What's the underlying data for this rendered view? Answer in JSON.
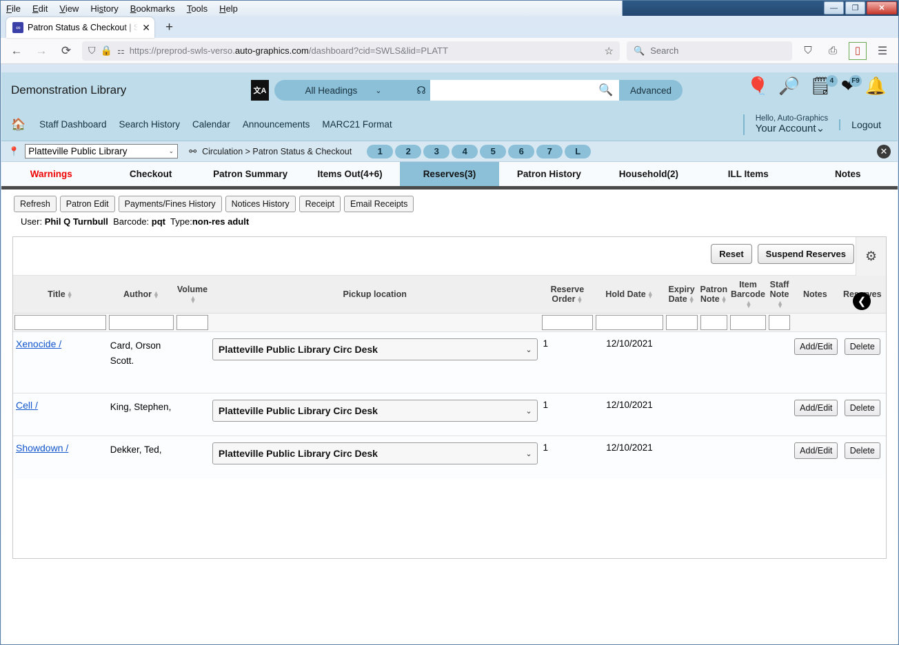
{
  "browser": {
    "menus": [
      "File",
      "Edit",
      "View",
      "History",
      "Bookmarks",
      "Tools",
      "Help"
    ],
    "window_controls": {
      "minimize": "—",
      "restore": "❐",
      "close": "✕"
    },
    "tab": {
      "title": "Patron Status & Checkout | SWL",
      "close": "✕",
      "newtab": "+"
    },
    "nav": {
      "back": "←",
      "forward": "→",
      "reload": "⟳"
    },
    "url": {
      "prefix": "https://preprod-swls-verso.",
      "host": "auto-graphics.com",
      "suffix": "/dashboard?cid=SWLS&lid=PLATT"
    },
    "search_placeholder": "Search",
    "bookmark_star": "☆"
  },
  "app": {
    "library_name": "Demonstration Library",
    "search": {
      "scope": "All Headings",
      "value": "",
      "advanced": "Advanced"
    },
    "account": {
      "hello": "Hello, Auto-Graphics",
      "your_account": "Your Account",
      "logout": "Logout"
    },
    "badges": {
      "list_count": "4",
      "heart_label": "F9"
    },
    "nav_links": [
      "Staff Dashboard",
      "Search History",
      "Calendar",
      "Announcements",
      "MARC21 Format"
    ],
    "breadcrumb": {
      "library": "Platteville Public Library",
      "path": "Circulation > Patron Status & Checkout",
      "pills": [
        "1",
        "2",
        "3",
        "4",
        "5",
        "6",
        "7",
        "L"
      ]
    },
    "tabs": [
      {
        "label": "Warnings",
        "state": "warning"
      },
      {
        "label": "Checkout",
        "state": "normal"
      },
      {
        "label": "Patron Summary",
        "state": "normal"
      },
      {
        "label": "Items Out(4+6)",
        "state": "normal"
      },
      {
        "label": "Reserves(3)",
        "state": "active"
      },
      {
        "label": "Patron History",
        "state": "normal"
      },
      {
        "label": "Household(2)",
        "state": "normal"
      },
      {
        "label": "ILL Items",
        "state": "normal"
      },
      {
        "label": "Notes",
        "state": "normal"
      }
    ],
    "action_buttons": [
      "Refresh",
      "Patron Edit",
      "Payments/Fines History",
      "Notices History",
      "Receipt",
      "Email Receipts"
    ],
    "patron": {
      "user_label": "User:",
      "user_name": "Phil Q Turnbull",
      "barcode_label": "Barcode:",
      "barcode": "pqt",
      "type_label": "Type:",
      "type": "non-res adult"
    },
    "panel": {
      "reset": "Reset",
      "suspend": "Suspend Reserves",
      "columns": [
        {
          "label": "Title",
          "sortable": true
        },
        {
          "label": "Author",
          "sortable": true
        },
        {
          "label": "Volume",
          "sortable": true
        },
        {
          "label": "Pickup location",
          "sortable": false
        },
        {
          "label": "Reserve Order",
          "sortable": true
        },
        {
          "label": "Hold Date",
          "sortable": true
        },
        {
          "label": "Expiry Date",
          "sortable": true
        },
        {
          "label": "Patron Note",
          "sortable": true
        },
        {
          "label": "Item Barcode",
          "sortable": true
        },
        {
          "label": "Staff Note",
          "sortable": true
        },
        {
          "label": "Notes",
          "sortable": false
        },
        {
          "label": "Reserves",
          "sortable": false
        }
      ],
      "rows": [
        {
          "title": "Xenocide /",
          "author": "Card, Orson Scott.",
          "volume": "",
          "pickup": "Platteville Public Library Circ Desk",
          "reserve_order": "1",
          "hold_date": "12/10/2021",
          "expiry_date": "",
          "patron_note": "",
          "item_barcode": "",
          "staff_note": "",
          "notes_button": "Add/Edit",
          "reserves_button": "Delete"
        },
        {
          "title": "Cell /",
          "author": "King, Stephen,",
          "volume": "",
          "pickup": "Platteville Public Library Circ Desk",
          "reserve_order": "1",
          "hold_date": "12/10/2021",
          "expiry_date": "",
          "patron_note": "",
          "item_barcode": "",
          "staff_note": "",
          "notes_button": "Add/Edit",
          "reserves_button": "Delete"
        },
        {
          "title": "Showdown /",
          "author": "Dekker, Ted,",
          "volume": "",
          "pickup": "Platteville Public Library Circ Desk",
          "reserve_order": "1",
          "hold_date": "12/10/2021",
          "expiry_date": "",
          "patron_note": "",
          "item_barcode": "",
          "staff_note": "",
          "notes_button": "Add/Edit",
          "reserves_button": "Delete"
        }
      ]
    }
  },
  "colors": {
    "header_bg": "#bedce9",
    "accent": "#8cc0d8",
    "warning": "#ef0000",
    "link": "#1155cc"
  }
}
